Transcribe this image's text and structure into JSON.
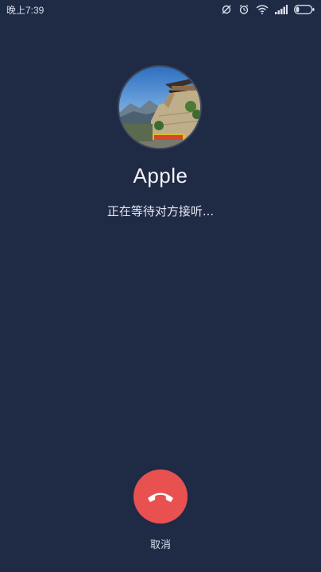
{
  "status_bar": {
    "time": "晚上7:39",
    "icons": [
      "sync-off-icon",
      "alarm-icon",
      "wifi-icon",
      "signal-icon",
      "battery-icon"
    ]
  },
  "contact": {
    "name": "Apple",
    "avatar": "avatar-photo-castle"
  },
  "call": {
    "status_text": "正在等待对方接听...",
    "end_call_label": "取消",
    "end_call_icon": "phone-hangup-icon"
  },
  "colors": {
    "background": "#1f2a44",
    "end_call": "#e8514f"
  }
}
